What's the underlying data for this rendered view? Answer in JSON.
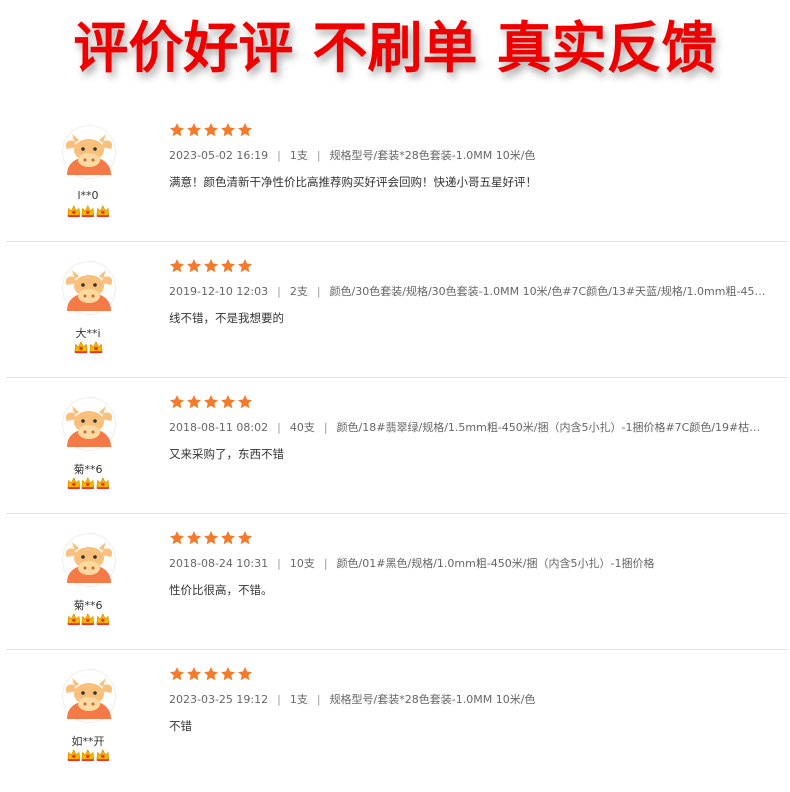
{
  "banner": {
    "title": "评价好评 不刷单 真实反馈"
  },
  "colors": {
    "banner_red": "#ef0000",
    "star_orange": "#f47a2c",
    "divider": "#e3e3e3"
  },
  "icons": {
    "avatar": "cow-avatar-icon",
    "star": "star-icon",
    "level": "crown-badge-icon"
  },
  "reviews": [
    {
      "username": "l**0",
      "level": 3,
      "rating": 5,
      "date": "2023-05-02 16:19",
      "quantity": "1支",
      "spec": "规格型号/套装*28色套装-1.0MM 10米/色",
      "comment": "满意！颜色清新干净性价比高推荐购买好评会回购！快递小哥五星好评！"
    },
    {
      "username": "大**i",
      "level": 2,
      "rating": 5,
      "date": "2019-12-10 12:03",
      "quantity": "2支",
      "spec": "颜色/30色套装/规格/30色套装-1.0MM 10米/色#7C颜色/13#天蓝/规格/1.0mm粗-450米/...",
      "comment": "线不错，不是我想要的"
    },
    {
      "username": "菊**6",
      "level": 3,
      "rating": 5,
      "date": "2018-08-11 08:02",
      "quantity": "40支",
      "spec": "颜色/18#翡翠绿/规格/1.5mm粗-450米/捆（内含5小扎）-1捆价格#7C颜色/19#枯草绿/...",
      "comment": "又来采购了，东西不错"
    },
    {
      "username": "菊**6",
      "level": 3,
      "rating": 5,
      "date": "2018-08-24 10:31",
      "quantity": "10支",
      "spec": "颜色/01#黑色/规格/1.0mm粗-450米/捆（内含5小扎）-1捆价格",
      "comment": "性价比很高，不错。"
    },
    {
      "username": "如**开",
      "level": 3,
      "rating": 5,
      "date": "2023-03-25 19:12",
      "quantity": "1支",
      "spec": "规格型号/套装*28色套装-1.0MM 10米/色",
      "comment": "不错"
    }
  ]
}
